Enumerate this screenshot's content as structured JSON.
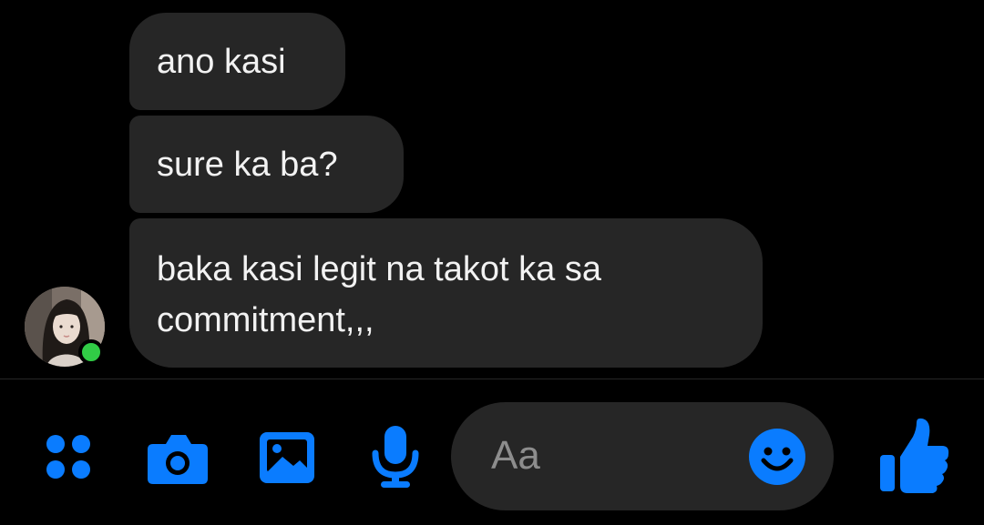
{
  "colors": {
    "background": "#000000",
    "bubble": "#262626",
    "accent": "#0a7cff",
    "online": "#31cc46",
    "placeholder": "#8d8d8d"
  },
  "messages": [
    {
      "text": "ano kasi"
    },
    {
      "text": "sure ka ba?"
    },
    {
      "text": "baka kasi legit na takot ka sa commitment,,,"
    }
  ],
  "sender": {
    "avatar_icon": "profile-photo",
    "online": true
  },
  "toolbar": {
    "icons": [
      "apps-grid-icon",
      "camera-icon",
      "gallery-icon",
      "microphone-icon",
      "emoji-icon",
      "thumbs-up-icon"
    ],
    "composer_placeholder": "Aa"
  }
}
